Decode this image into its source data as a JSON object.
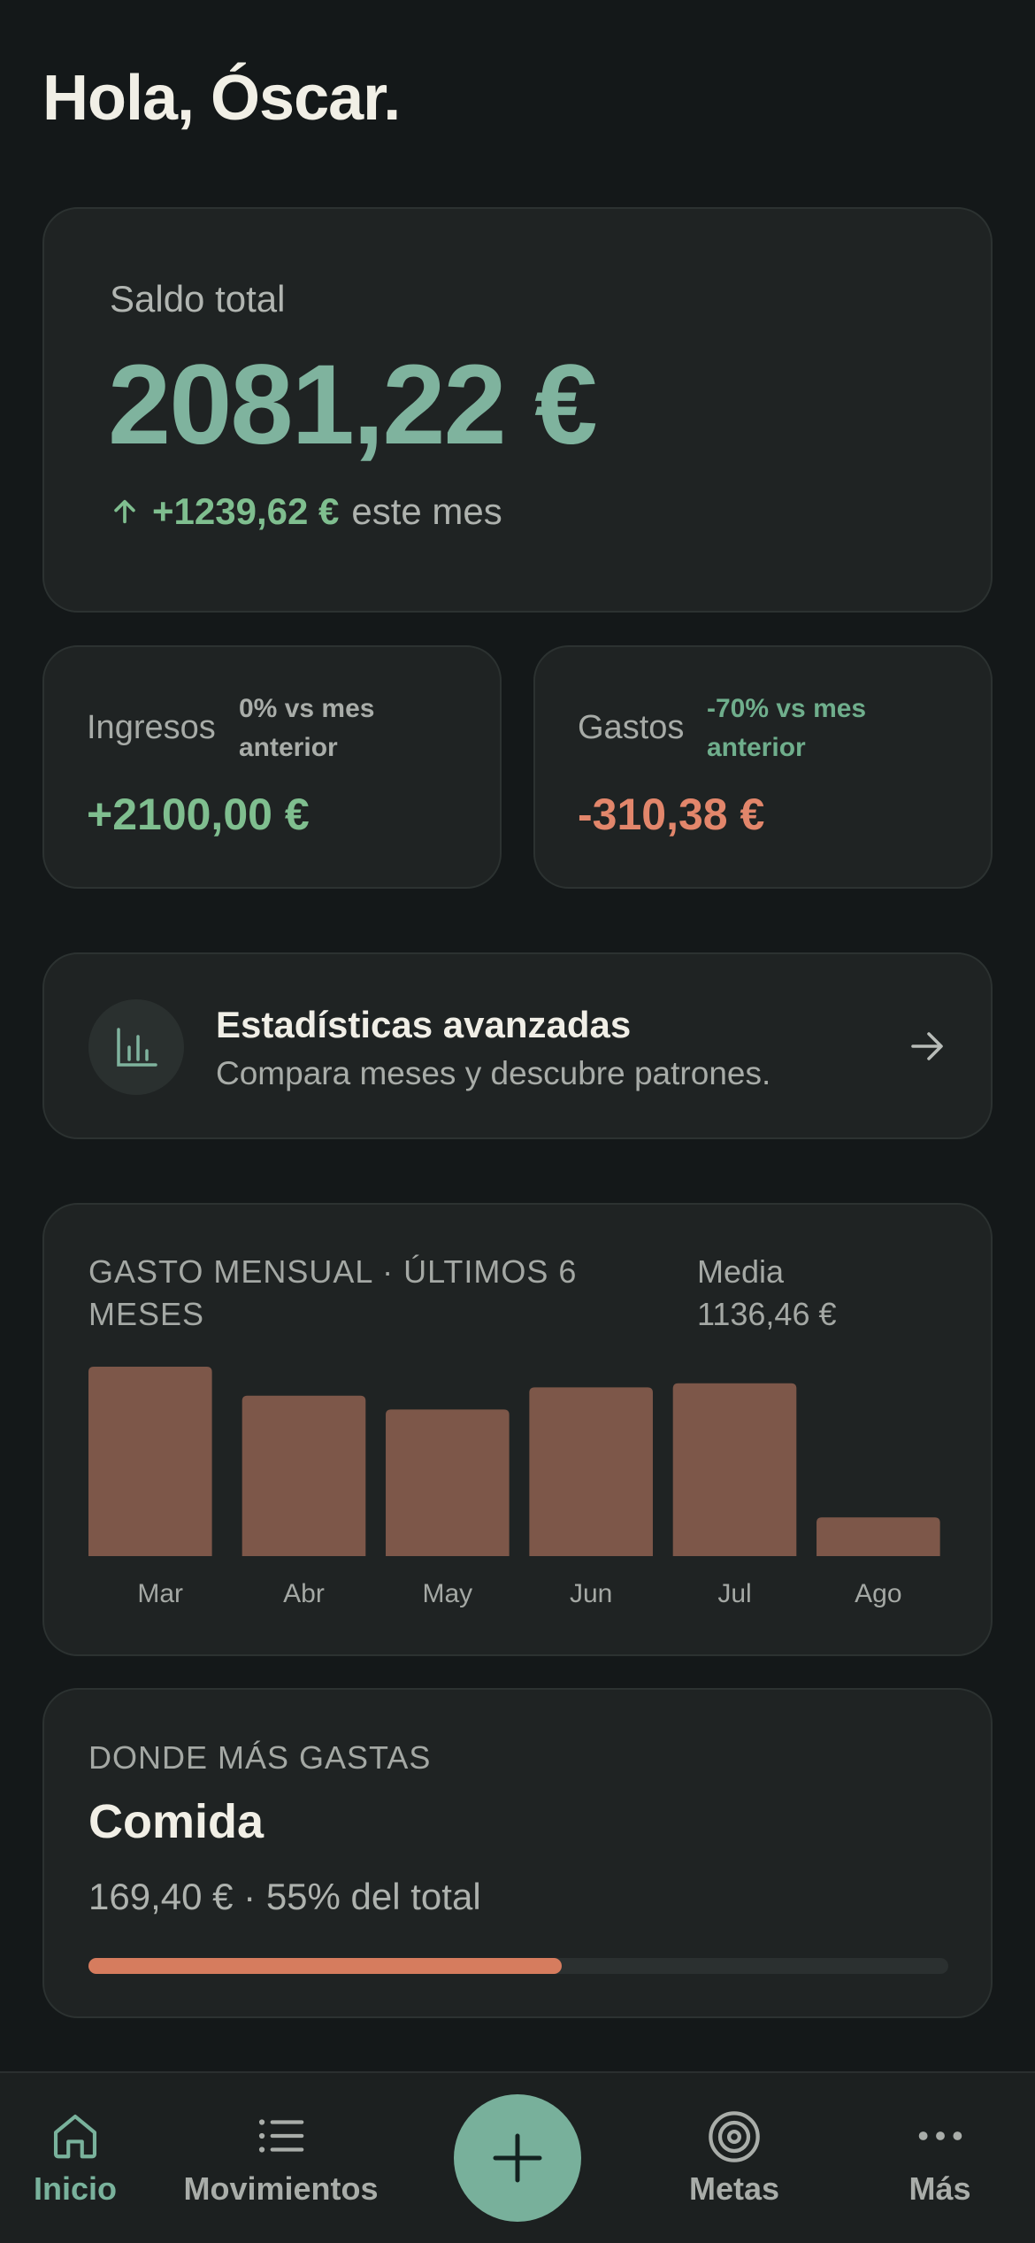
{
  "greeting": "Hola, Óscar.",
  "balance": {
    "label": "Saldo total",
    "amount": "2081,22 €",
    "delta_value": "+1239,62 €",
    "delta_suffix": "este mes"
  },
  "income": {
    "label": "Ingresos",
    "comparison": "0% vs mes anterior",
    "amount": "+2100,00 €"
  },
  "expenses": {
    "label": "Gastos",
    "comparison": "-70% vs mes anterior",
    "amount": "-310,38 €"
  },
  "stats_link": {
    "title": "Estadísticas avanzadas",
    "subtitle": "Compara meses y descubre patrones."
  },
  "monthly": {
    "title": "GASTO MENSUAL · ÚLTIMOS 6 MESES",
    "average_label": "Media",
    "average_value": "1136,46 €"
  },
  "chart_data": {
    "type": "bar",
    "title": "GASTO MENSUAL · ÚLTIMOS 6 MESES",
    "categories": [
      "Mar",
      "Abr",
      "May",
      "Jun",
      "Jul",
      "Ago"
    ],
    "values": [
      1370,
      1160,
      1060,
      1220,
      1250,
      280
    ],
    "xlabel": "",
    "ylabel": "",
    "ylim": [
      0,
      1370
    ],
    "grid": false,
    "bar_color": "#7d5749"
  },
  "top_category": {
    "heading": "DONDE MÁS GASTAS",
    "name": "Comida",
    "detail": "169,40 € · 55% del total",
    "share": 0.55
  },
  "nav": {
    "home": "Inicio",
    "movements": "Movimientos",
    "goals": "Metas",
    "more": "Más",
    "add_icon": "plus-icon"
  },
  "colors": {
    "accent": "#78b09b",
    "positive": "#7fbe8f",
    "negative": "#e2866b",
    "bar": "#7d5749",
    "progress": "#d67c5e"
  }
}
